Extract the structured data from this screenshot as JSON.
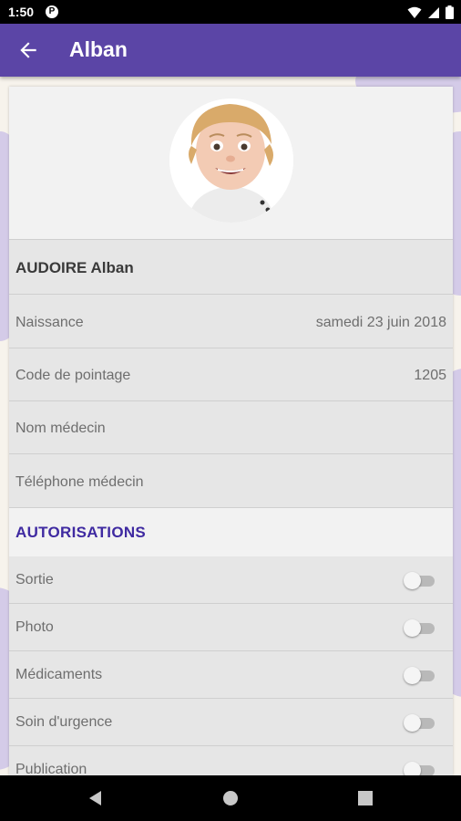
{
  "status": {
    "time": "1:50",
    "app_badge": "P"
  },
  "appbar": {
    "title": "Alban"
  },
  "profile": {
    "full_name": "AUDOIRE  Alban",
    "birth_label": "Naissance",
    "birth_value": "samedi 23 juin 2018",
    "code_label": "Code de pointage",
    "code_value": "1205",
    "doctor_label": "Nom médecin",
    "doctor_phone_label": "Téléphone médecin"
  },
  "authorizations": {
    "heading": "AUTORISATIONS",
    "items": [
      {
        "label": "Sortie",
        "enabled": false
      },
      {
        "label": "Photo",
        "enabled": false
      },
      {
        "label": "Médicaments",
        "enabled": false
      },
      {
        "label": "Soin d'urgence",
        "enabled": false
      },
      {
        "label": "Publication",
        "enabled": false
      }
    ]
  },
  "colors": {
    "appbar": "#5b45a6",
    "accent": "#3f2aa1",
    "background": "#f7f3ec"
  },
  "icons": {
    "back": "arrow-left-icon",
    "nav_back": "triangle-back-icon",
    "nav_home": "circle-home-icon",
    "nav_recents": "square-recents-icon"
  }
}
